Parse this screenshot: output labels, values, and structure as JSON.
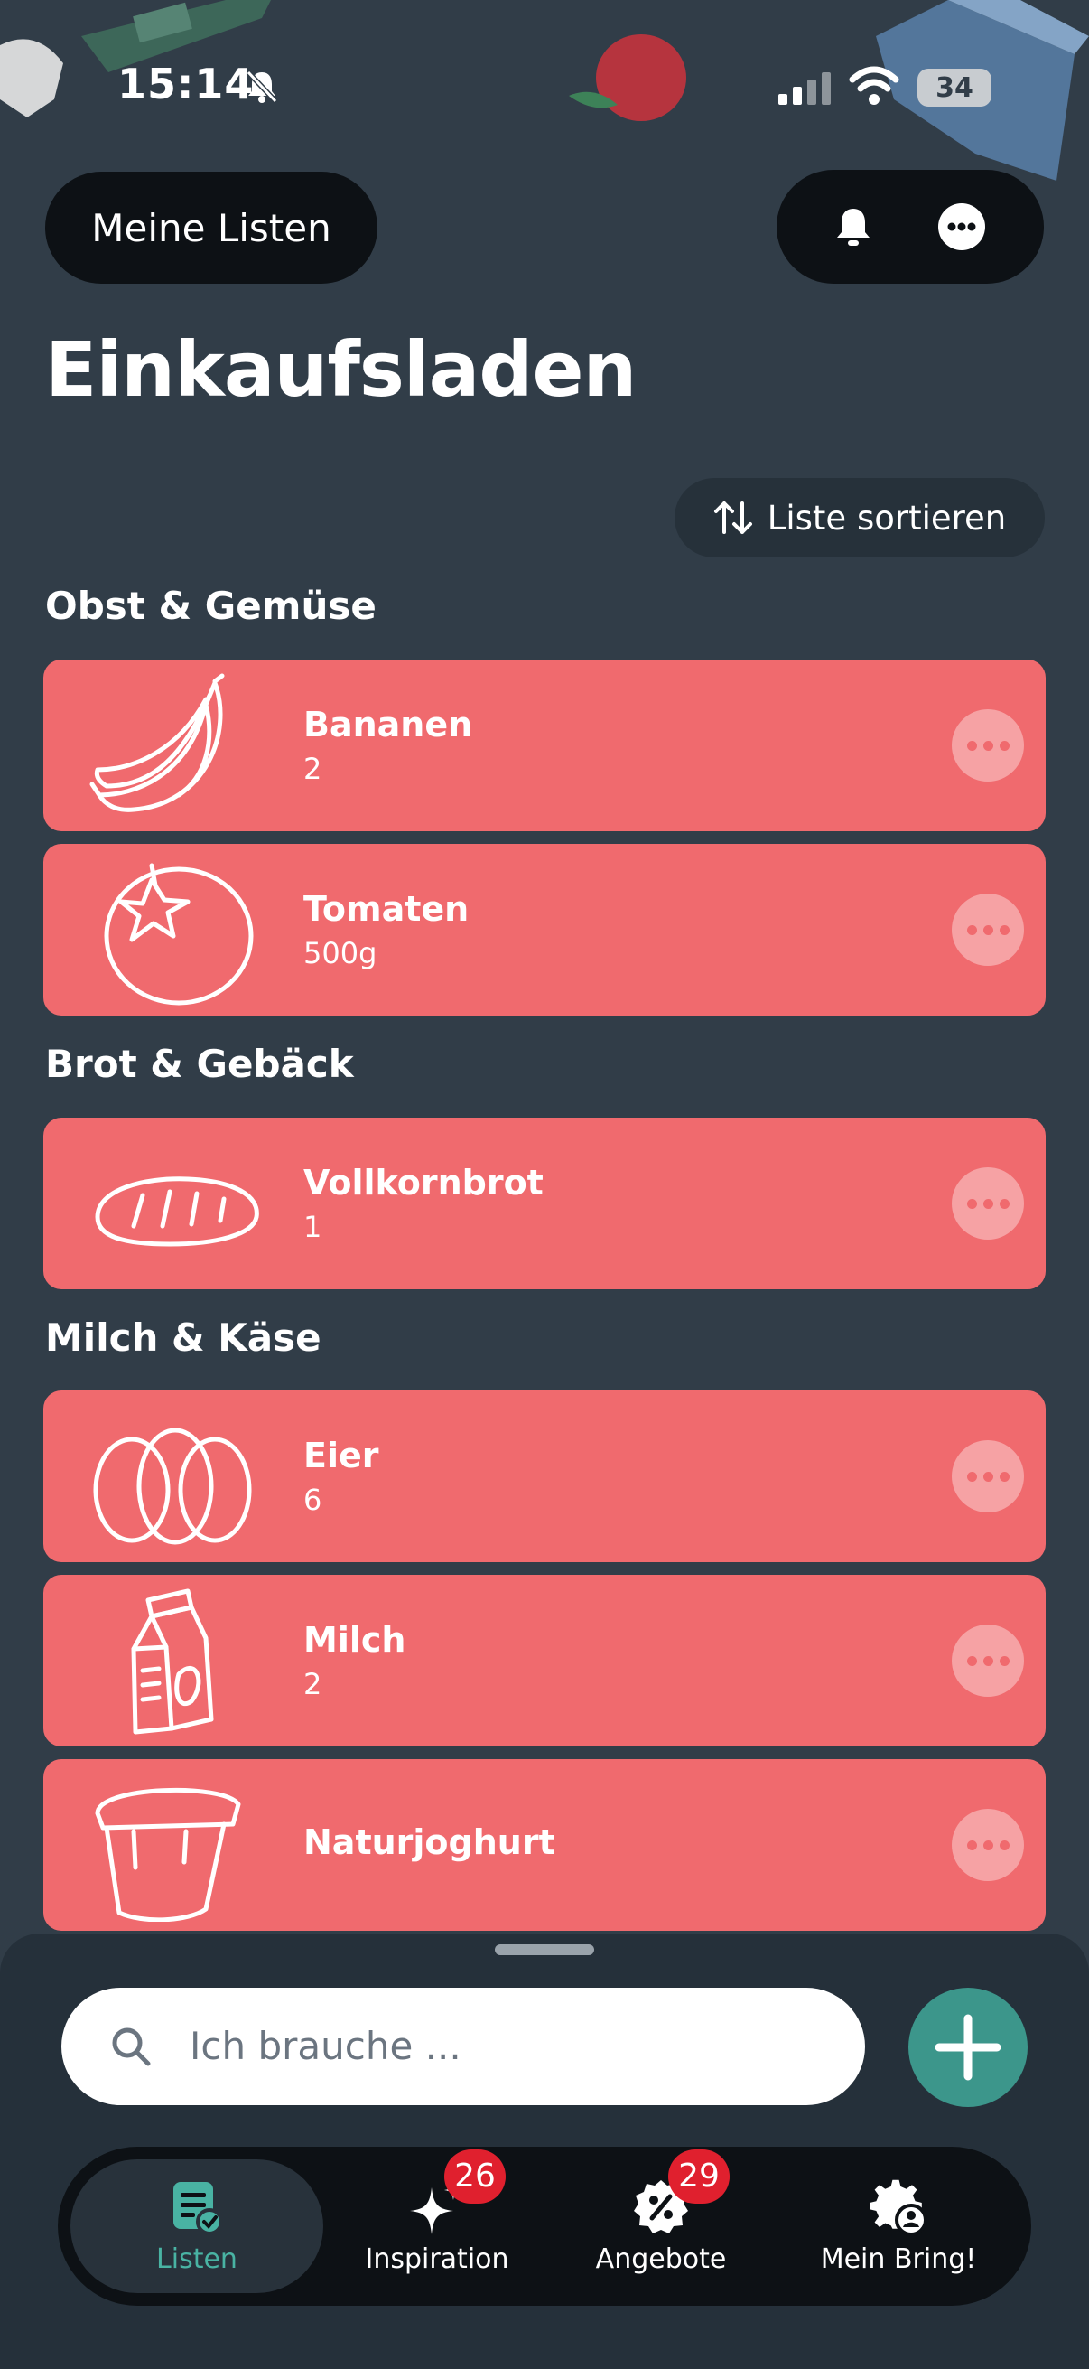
{
  "status_bar": {
    "time": "15:14",
    "battery": "34"
  },
  "header": {
    "lists_button": "Meine Listen",
    "title": "Einkaufsladen"
  },
  "sort_button": "Liste sortieren",
  "sections": [
    {
      "title": "Obst & Gemüse",
      "items": [
        {
          "name": "Bananen",
          "qty": "2",
          "icon": "banana-icon"
        },
        {
          "name": "Tomaten",
          "qty": "500g",
          "icon": "tomato-icon"
        }
      ]
    },
    {
      "title": "Brot & Gebäck",
      "items": [
        {
          "name": "Vollkornbrot",
          "qty": "1",
          "icon": "bread-icon"
        }
      ]
    },
    {
      "title": "Milch & Käse",
      "items": [
        {
          "name": "Eier",
          "qty": "6",
          "icon": "eggs-icon"
        },
        {
          "name": "Milch",
          "qty": "2",
          "icon": "milk-icon"
        },
        {
          "name": "Naturjoghurt",
          "qty": "",
          "icon": "yogurt-icon"
        }
      ]
    }
  ],
  "search": {
    "placeholder": "Ich brauche ..."
  },
  "tabs": [
    {
      "label": "Listen",
      "badge": ""
    },
    {
      "label": "Inspiration",
      "badge": "26"
    },
    {
      "label": "Angebote",
      "badge": "29"
    },
    {
      "label": "Mein Bring!",
      "badge": ""
    }
  ],
  "colors": {
    "background": "#313d48",
    "item": "#f06a6e",
    "accent": "#3c968b",
    "badge": "#e0202e",
    "active_tab_text": "#49b3a3"
  }
}
